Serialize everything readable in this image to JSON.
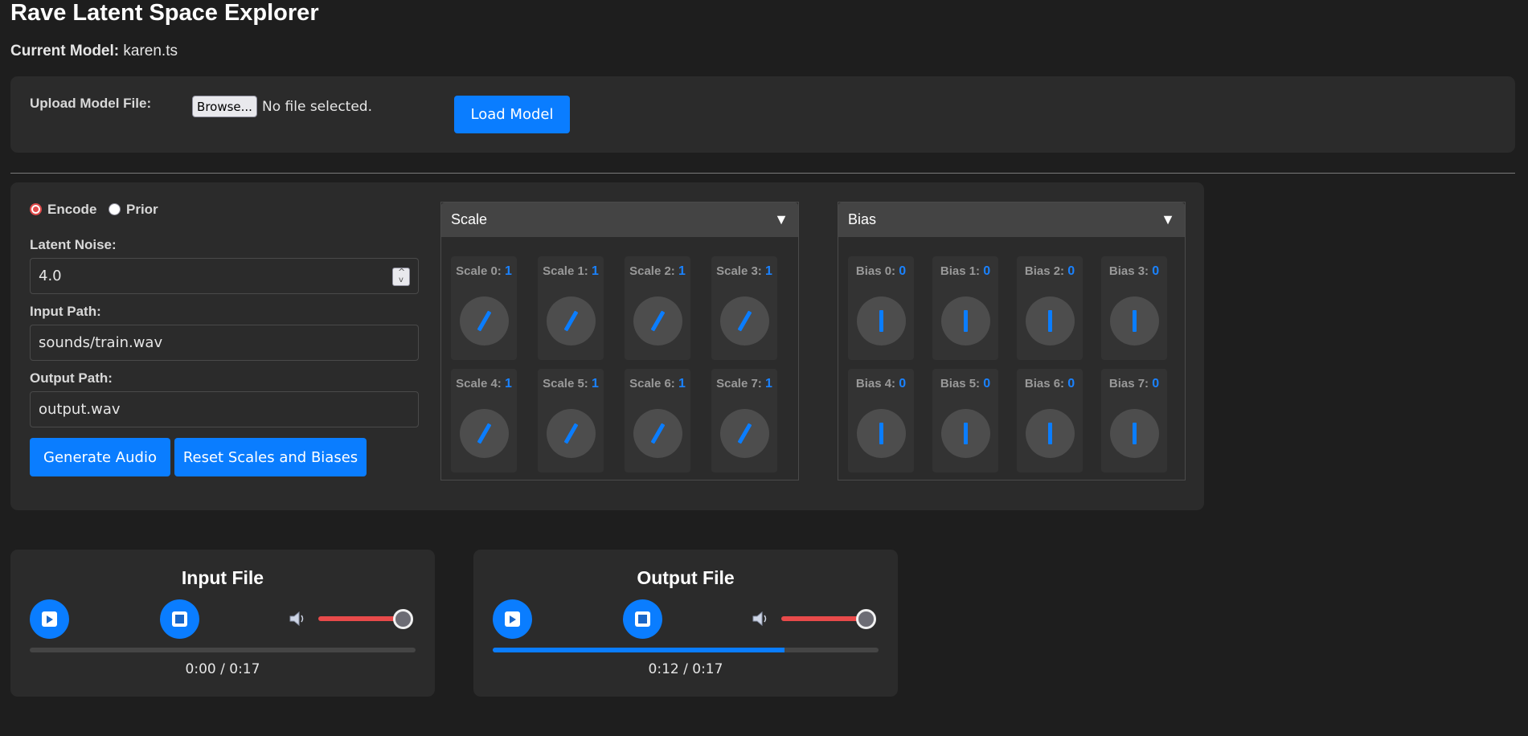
{
  "app": {
    "title": "Rave Latent Space Explorer",
    "current_model_label": "Current Model:",
    "current_model_value": "karen.ts"
  },
  "upload": {
    "label": "Upload Model File:",
    "browse_label": "Browse...",
    "file_status": "No file selected.",
    "load_button": "Load Model"
  },
  "mode": {
    "options": [
      {
        "label": "Encode",
        "selected": true
      },
      {
        "label": "Prior",
        "selected": false
      }
    ]
  },
  "fields": {
    "latent_noise_label": "Latent Noise:",
    "latent_noise_value": "4.0",
    "input_path_label": "Input Path:",
    "input_path_value": "sounds/train.wav",
    "output_path_label": "Output Path:",
    "output_path_value": "output.wav"
  },
  "actions": {
    "generate": "Generate Audio",
    "reset": "Reset Scales and Biases"
  },
  "scale": {
    "title": "Scale",
    "arrow": "▼",
    "knobs": [
      {
        "label": "Scale 0:",
        "value": "1"
      },
      {
        "label": "Scale 1:",
        "value": "1"
      },
      {
        "label": "Scale 2:",
        "value": "1"
      },
      {
        "label": "Scale 3:",
        "value": "1"
      },
      {
        "label": "Scale 4:",
        "value": "1"
      },
      {
        "label": "Scale 5:",
        "value": "1"
      },
      {
        "label": "Scale 6:",
        "value": "1"
      },
      {
        "label": "Scale 7:",
        "value": "1"
      }
    ]
  },
  "bias": {
    "title": "Bias",
    "arrow": "▼",
    "knobs": [
      {
        "label": "Bias 0:",
        "value": "0"
      },
      {
        "label": "Bias 1:",
        "value": "0"
      },
      {
        "label": "Bias 2:",
        "value": "0"
      },
      {
        "label": "Bias 3:",
        "value": "0"
      },
      {
        "label": "Bias 4:",
        "value": "0"
      },
      {
        "label": "Bias 5:",
        "value": "0"
      },
      {
        "label": "Bias 6:",
        "value": "0"
      },
      {
        "label": "Bias 7:",
        "value": "0"
      }
    ]
  },
  "players": {
    "input": {
      "title": "Input File",
      "time": "0:00 / 0:17",
      "progress": 0.0,
      "volume": 1.0
    },
    "output": {
      "title": "Output File",
      "time": "0:12 / 0:17",
      "progress": 0.757,
      "volume": 1.0
    }
  },
  "colors": {
    "accent": "#0a7dff",
    "volume": "#e84a4a",
    "background": "#1e1e1e",
    "panel": "#2b2b2b"
  }
}
